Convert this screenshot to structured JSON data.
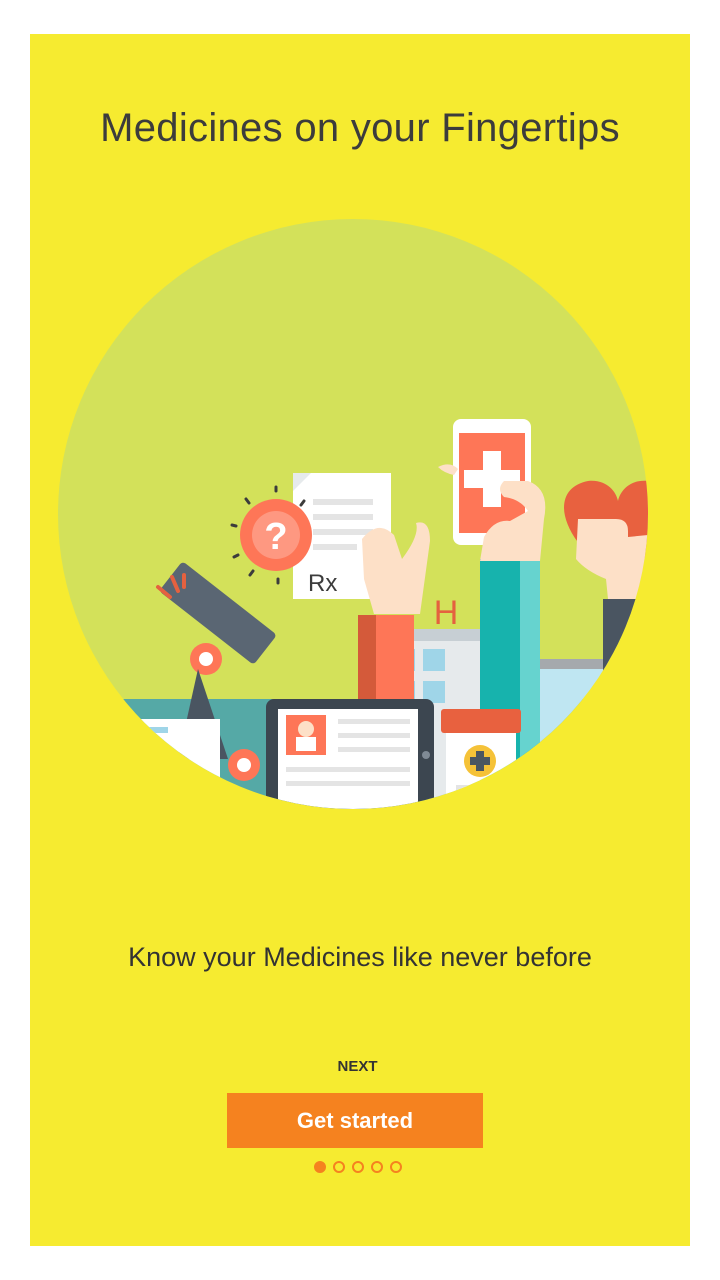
{
  "onboarding": {
    "title": "Medicines on your Fingertips",
    "subtitle": "Know your Medicines like never before",
    "next_label": "NEXT",
    "cta_label": "Get started",
    "page_indicator": {
      "total": 5,
      "current": 1
    }
  },
  "illustration": {
    "rx_label": "Rx",
    "hospital_sign": "H"
  },
  "colors": {
    "background": "#f6eb30",
    "accent": "#f5821f",
    "circle": "#d3e15a"
  }
}
